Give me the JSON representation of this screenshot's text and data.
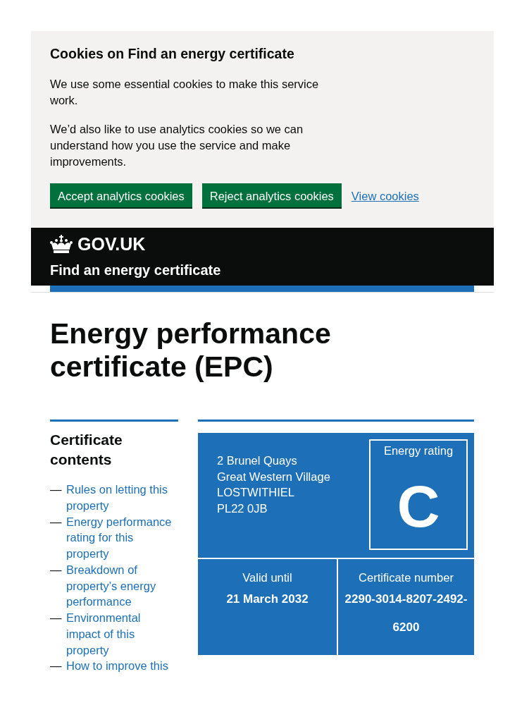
{
  "cookie_banner": {
    "heading": "Cookies on Find an energy certificate",
    "paragraphs": [
      "We use some essential cookies to make this service work.",
      "We’d also like to use analytics cookies so we can understand how you use the service and make improvements."
    ],
    "actions": [
      {
        "kind": "button",
        "label": "Accept analytics cookies"
      },
      {
        "kind": "button",
        "label": "Reject analytics cookies"
      },
      {
        "kind": "link",
        "label": "View cookies"
      }
    ]
  },
  "header": {
    "logotype": "GOV.UK",
    "service_name": "Find an energy certificate"
  },
  "page_title": "Energy performance certificate (EPC)",
  "contents_nav": {
    "heading": "Certificate contents",
    "items": [
      {
        "marker": "—",
        "label": "Rules on letting this property"
      },
      {
        "marker": "—",
        "label": "Energy performance rating for this property"
      },
      {
        "marker": "—",
        "label": "Breakdown of property’s energy performance"
      },
      {
        "marker": "—",
        "label": "Environmental impact of this property"
      },
      {
        "marker": "—",
        "label": "How to improve this"
      }
    ]
  },
  "certificate": {
    "address_lines": [
      "2 Brunel Quays",
      "Great Western Village",
      "LOSTWITHIEL",
      "PL22 0JB"
    ],
    "rating_label": "Energy rating",
    "rating": "C",
    "details": [
      {
        "label": "Valid until",
        "value": "21 March 2032"
      },
      {
        "label": "Certificate number",
        "value": "2290-3014-8207-2492-6200"
      }
    ]
  }
}
